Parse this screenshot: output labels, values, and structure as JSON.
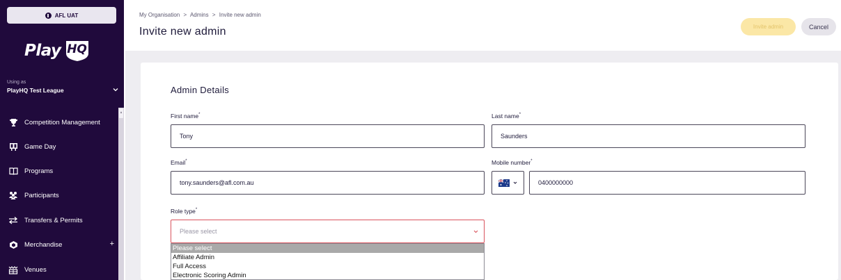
{
  "sidebar": {
    "env_label": "AFL UAT",
    "logo_text": "Play",
    "logo_badge": "HQ",
    "using_as_label": "Using as",
    "using_as_value": "PlayHQ Test League",
    "nav": [
      {
        "label": "Competition Management",
        "icon": "trophy-icon"
      },
      {
        "label": "Game Day",
        "icon": "scoreboard-icon"
      },
      {
        "label": "Programs",
        "icon": "book-icon"
      },
      {
        "label": "Participants",
        "icon": "people-icon"
      },
      {
        "label": "Transfers & Permits",
        "icon": "transfer-arrows-icon"
      },
      {
        "label": "Merchandise",
        "icon": "shirt-icon",
        "expand": "+"
      },
      {
        "label": "Venues",
        "icon": "stadium-icon"
      }
    ]
  },
  "header": {
    "breadcrumb": [
      "My Organisation",
      "Admins",
      "Invite new admin"
    ],
    "breadcrumb_sep": ">",
    "title": "Invite new admin",
    "invite_button": "Invite admin",
    "cancel_button": "Cancel"
  },
  "form": {
    "section_title": "Admin Details",
    "first_name": {
      "label": "First name",
      "value": "Tony"
    },
    "last_name": {
      "label": "Last name",
      "value": "Saunders"
    },
    "email": {
      "label": "Email",
      "value": "tony.saunders@afl.com.au"
    },
    "mobile": {
      "label": "Mobile number",
      "country": "Australia",
      "value": "0400000000"
    },
    "role_type": {
      "label": "Role type",
      "placeholder": "Please select",
      "options": [
        "Please select",
        "Affiliate Admin",
        "Full Access",
        "Electronic Scoring Admin"
      ],
      "selected_index": 0
    },
    "required_mark": "*"
  },
  "colors": {
    "sidebar_bg": "#200a3c",
    "accent_disabled": "#fbe7a6",
    "error_border": "#d9525c",
    "content_bg": "#eeedf1"
  }
}
